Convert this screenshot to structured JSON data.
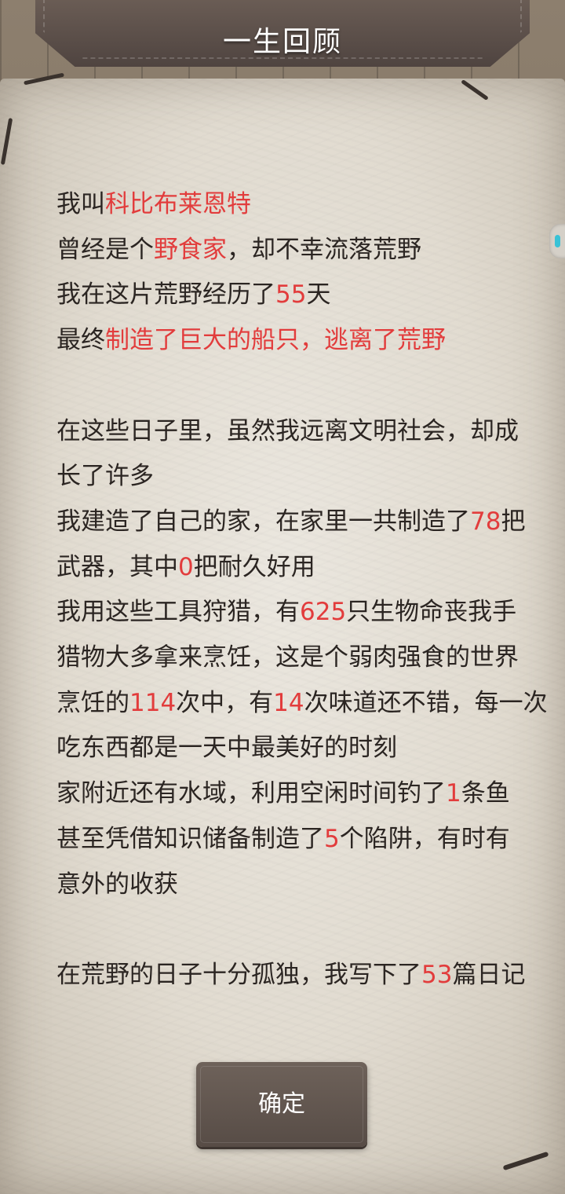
{
  "header": {
    "title": "一生回顾"
  },
  "summary": [
    [
      {
        "t": "我叫",
        "h": false
      },
      {
        "t": "科比布莱恩特",
        "h": true
      }
    ],
    [
      {
        "t": "曾经是个",
        "h": false
      },
      {
        "t": "野食家",
        "h": true
      },
      {
        "t": "，却不幸流落荒野",
        "h": false
      }
    ],
    [
      {
        "t": "我在这片荒野经历了",
        "h": false
      },
      {
        "t": "55",
        "h": true
      },
      {
        "t": "天",
        "h": false
      }
    ],
    [
      {
        "t": "最终",
        "h": false
      },
      {
        "t": "制造了巨大的船只，逃离了荒野",
        "h": true
      }
    ],
    [],
    [
      {
        "t": "在这些日子里，虽然我远离文明社会，却成",
        "h": false
      }
    ],
    [
      {
        "t": "长了许多",
        "h": false
      }
    ],
    [
      {
        "t": "我建造了自己的家，在家里一共制造了",
        "h": false
      },
      {
        "t": "78",
        "h": true
      },
      {
        "t": "把",
        "h": false
      }
    ],
    [
      {
        "t": "武器，其中",
        "h": false
      },
      {
        "t": "0",
        "h": true
      },
      {
        "t": "把耐久好用",
        "h": false
      }
    ],
    [
      {
        "t": "我用这些工具狩猎，有",
        "h": false
      },
      {
        "t": "625",
        "h": true
      },
      {
        "t": "只生物命丧我手",
        "h": false
      }
    ],
    [
      {
        "t": "猎物大多拿来烹饪，这是个弱肉强食的世界",
        "h": false
      }
    ],
    [
      {
        "t": "烹饪的",
        "h": false
      },
      {
        "t": "114",
        "h": true
      },
      {
        "t": "次中，有",
        "h": false
      },
      {
        "t": "14",
        "h": true
      },
      {
        "t": "次味道还不错，每一次",
        "h": false
      }
    ],
    [
      {
        "t": "吃东西都是一天中最美好的时刻",
        "h": false
      }
    ],
    [
      {
        "t": "家附近还有水域，利用空闲时间钓了",
        "h": false
      },
      {
        "t": "1",
        "h": true
      },
      {
        "t": "条鱼",
        "h": false
      }
    ],
    [
      {
        "t": "甚至凭借知识储备制造了",
        "h": false
      },
      {
        "t": "5",
        "h": true
      },
      {
        "t": "个陷阱，有时有",
        "h": false
      }
    ],
    [
      {
        "t": "意外的收获",
        "h": false
      }
    ],
    [],
    [
      {
        "t": "在荒野的日子十分孤独，我写下了",
        "h": false
      },
      {
        "t": "53",
        "h": true
      },
      {
        "t": "篇日记",
        "h": false
      }
    ]
  ],
  "buttons": {
    "confirm_label": "确定"
  },
  "colors": {
    "highlight": "#e23c3c",
    "text": "#2b2522",
    "button": "#5f544d"
  }
}
